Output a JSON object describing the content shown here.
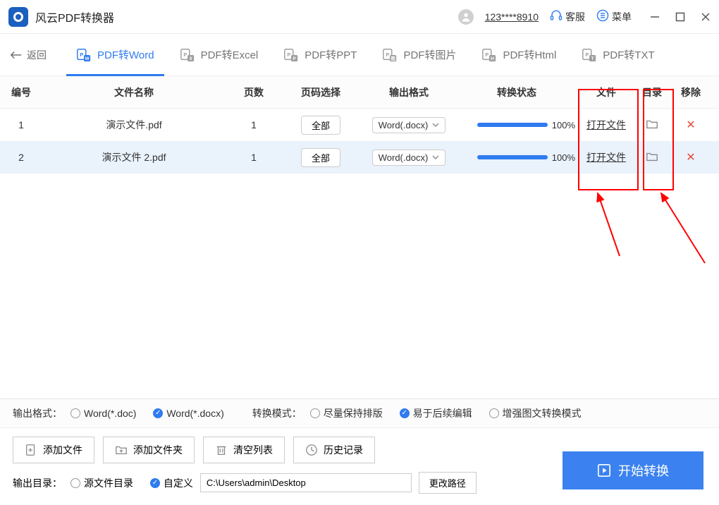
{
  "app_title": "风云PDF转换器",
  "user_id": "123****8910",
  "titlebar": {
    "support": "客服",
    "menu": "菜单"
  },
  "back_label": "返回",
  "tabs": [
    {
      "label": "PDF转Word",
      "active": true
    },
    {
      "label": "PDF转Excel"
    },
    {
      "label": "PDF转PPT"
    },
    {
      "label": "PDF转图片"
    },
    {
      "label": "PDF转Html"
    },
    {
      "label": "PDF转TXT"
    }
  ],
  "columns": {
    "num": "编号",
    "name": "文件名称",
    "pages": "页数",
    "pagesel": "页码选择",
    "format": "输出格式",
    "status": "转换状态",
    "file": "文件",
    "dir": "目录",
    "remove": "移除"
  },
  "page_all_label": "全部",
  "format_option": "Word(.docx)",
  "open_file_label": "打开文件",
  "rows": [
    {
      "num": "1",
      "name": "演示文件.pdf",
      "pages": "1",
      "pct": "100%"
    },
    {
      "num": "2",
      "name": "演示文件 2.pdf",
      "pages": "1",
      "pct": "100%"
    }
  ],
  "output_format_label": "输出格式：",
  "output_formats": [
    {
      "label": "Word(*.doc)",
      "checked": false
    },
    {
      "label": "Word(*.docx)",
      "checked": true
    }
  ],
  "convert_mode_label": "转换模式：",
  "convert_modes": [
    {
      "label": "尽量保持排版",
      "checked": false
    },
    {
      "label": "易于后续编辑",
      "checked": true
    },
    {
      "label": "增强图文转换模式",
      "checked": false
    }
  ],
  "actions": {
    "add_file": "添加文件",
    "add_folder": "添加文件夹",
    "clear": "清空列表",
    "history": "历史记录"
  },
  "output_dir_label": "输出目录：",
  "output_dir_options": [
    {
      "label": "源文件目录",
      "checked": false
    },
    {
      "label": "自定义",
      "checked": true
    }
  ],
  "output_path": "C:\\Users\\admin\\Desktop",
  "change_path_label": "更改路径",
  "start_label": "开始转换"
}
